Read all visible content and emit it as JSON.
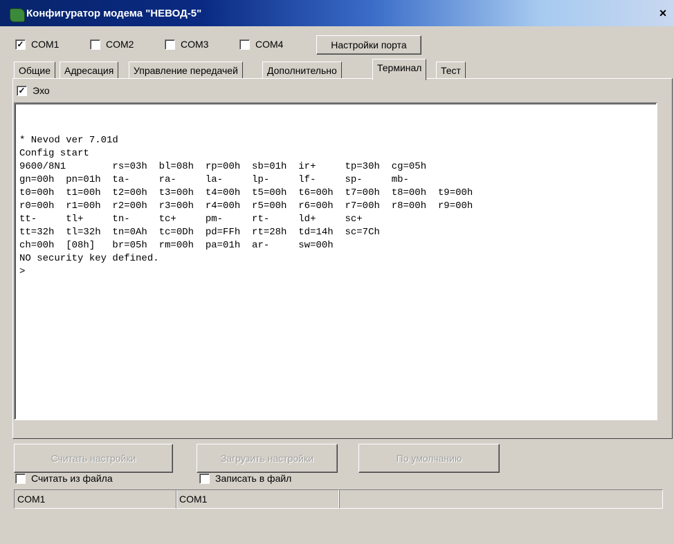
{
  "window": {
    "title": "Конфигуратор модема \"НЕВОД-5\"",
    "close_glyph": "×"
  },
  "ports": [
    {
      "label": "COM1",
      "checked": true
    },
    {
      "label": "COM2",
      "checked": false
    },
    {
      "label": "COM3",
      "checked": false
    },
    {
      "label": "COM4",
      "checked": false
    }
  ],
  "port_settings_button": "Настройки порта",
  "tabs": [
    {
      "label": "Общие"
    },
    {
      "label": "Адресация"
    },
    {
      "label": "Управление передачей"
    },
    {
      "label": "Дополнительно"
    },
    {
      "label": "Терминал",
      "active": true
    },
    {
      "label": "Тест"
    }
  ],
  "echo": {
    "label": "Эхо",
    "checked": true
  },
  "terminal": {
    "lines": [
      "* Nevod ver 7.01d",
      "Config start",
      "9600/8N1        rs=03h  bl=08h  rp=00h  sb=01h  ir+     tp=30h  cg=05h",
      "gn=00h  pn=01h  ta-     ra-     la-     lp-     lf-     sp-     mb-",
      "t0=00h  t1=00h  t2=00h  t3=00h  t4=00h  t5=00h  t6=00h  t7=00h  t8=00h  t9=00h",
      "r0=00h  r1=00h  r2=00h  r3=00h  r4=00h  r5=00h  r6=00h  r7=00h  r8=00h  r9=00h",
      "tt-     tl+     tn-     tc+     pm-     rt-     ld+     sc+",
      "tt=32h  tl=32h  tn=0Ah  tc=0Dh  pd=FFh  rt=28h  td=14h  sc=7Ch",
      "ch=00h  [08h]   br=05h  rm=00h  pa=01h  ar-     sw=00h",
      "NO security key defined.",
      ">"
    ]
  },
  "buttons": {
    "read_settings": "Считать настройки",
    "load_settings": "Загрузить настройки",
    "defaults": "По умолчанию"
  },
  "file_options": {
    "read_from_file": {
      "label": "Считать из файла",
      "checked": false
    },
    "write_to_file": {
      "label": "Записать в файл",
      "checked": false
    }
  },
  "statusbar": {
    "cell1": "COM1",
    "cell2": "COM1",
    "cell3": ""
  }
}
